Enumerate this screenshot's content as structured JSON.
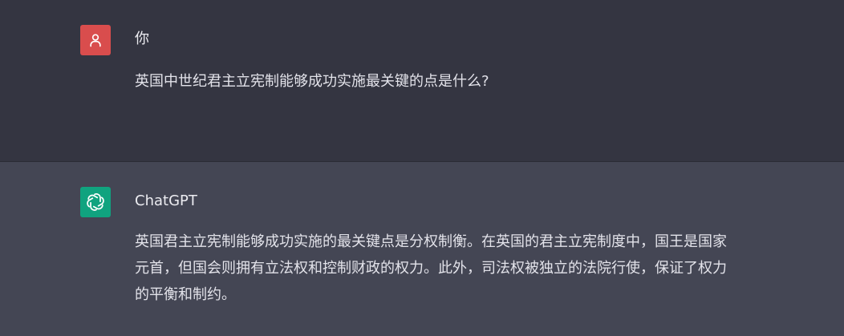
{
  "colors": {
    "user_bg": "#343541",
    "assistant_bg": "#444654",
    "user_avatar": "#d94d4d",
    "assistant_avatar": "#10a37f",
    "text": "#ececf1"
  },
  "messages": [
    {
      "role": "user",
      "author": "你",
      "avatar_icon": "user-icon",
      "text": "英国中世纪君主立宪制能够成功实施最关键的点是什么?"
    },
    {
      "role": "assistant",
      "author": "ChatGPT",
      "avatar_icon": "openai-logo-icon",
      "text": "英国君主立宪制能够成功实施的最关键点是分权制衡。在英国的君主立宪制度中，国王是国家元首，但国会则拥有立法权和控制财政的权力。此外，司法权被独立的法院行使，保证了权力的平衡和制约。"
    }
  ]
}
